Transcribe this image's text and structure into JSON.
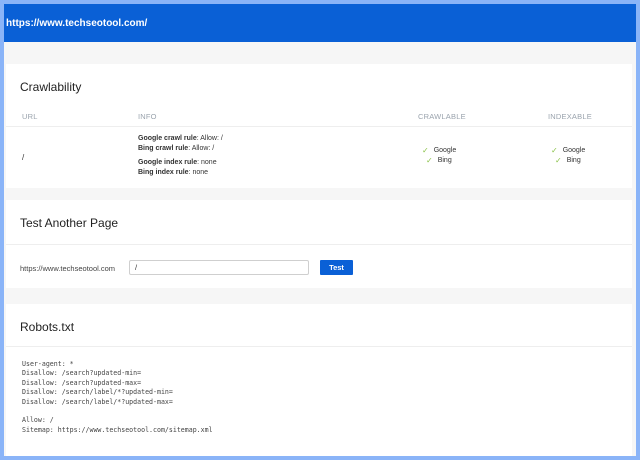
{
  "topbar": {
    "url": "https://www.techseotool.com/"
  },
  "crawlability": {
    "title": "Crawlability",
    "headers": {
      "url": "URL",
      "info": "INFO",
      "crawlable": "CRAWLABLE",
      "indexable": "INDEXABLE"
    },
    "row": {
      "url": "/",
      "info": [
        {
          "label": "Google crawl rule",
          "value": ": Allow: /"
        },
        {
          "label": "Bing crawl rule",
          "value": ": Allow: /"
        },
        {
          "label": "Google index rule",
          "value": ": none"
        },
        {
          "label": "Bing index rule",
          "value": ": none"
        }
      ],
      "crawlable": [
        "Google",
        "Bing"
      ],
      "indexable": [
        "Google",
        "Bing"
      ]
    },
    "check_color": "#8bc34a"
  },
  "test": {
    "title": "Test Another Page",
    "domain": "https://www.techseotool.com",
    "path_value": "/",
    "button_label": "Test"
  },
  "robots": {
    "title": "Robots.txt",
    "content": "User-agent: *\nDisallow: /search?updated-min=\nDisallow: /search?updated-max=\nDisallow: /search/label/*?updated-min=\nDisallow: /search/label/*?updated-max=\n\nAllow: /\nSitemap: https://www.techseotool.com/sitemap.xml"
  },
  "colors": {
    "accent": "#0a60d6",
    "frame": "#8ab4f8"
  }
}
